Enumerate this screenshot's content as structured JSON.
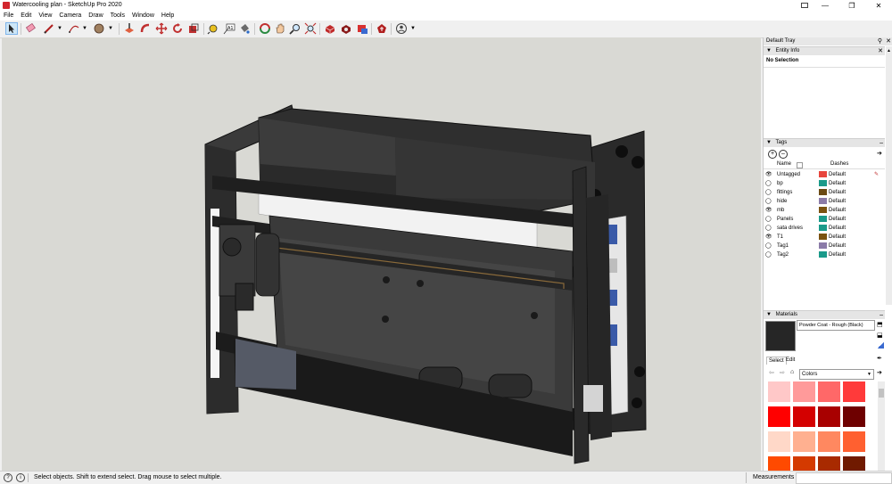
{
  "window": {
    "title": "Watercooling plan - SketchUp Pro 2020",
    "min": "—",
    "restore": "❐",
    "close": "✕"
  },
  "menu": [
    "File",
    "Edit",
    "View",
    "Camera",
    "Draw",
    "Tools",
    "Window",
    "Help"
  ],
  "toolbar": {
    "tools": [
      "select-tool",
      "eraser-tool",
      "line-tool",
      "arc-tool",
      "shapes-tool",
      "push-pull-tool",
      "move-tool",
      "rotate-tool",
      "scale-tool",
      "offset-tool",
      "tape-measure-tool",
      "text-tool",
      "paint-bucket-tool",
      "orbit-tool",
      "pan-tool",
      "zoom-tool",
      "zoom-extents-tool",
      "warehouse-tool",
      "extension-warehouse-tool",
      "layout-send-tool",
      "extension-manager-tool",
      "account-tool"
    ]
  },
  "tray": {
    "title": "Default Tray",
    "entity_info": {
      "label": "Entity Info",
      "status": "No Selection"
    },
    "tags": {
      "label": "Tags",
      "col_name": "Name",
      "col_dashes": "Dashes",
      "rows": [
        {
          "name": "Untagged",
          "color": "#e8453c",
          "dash": "Default",
          "visible": true
        },
        {
          "name": "bp",
          "color": "#1a9a8a",
          "dash": "Default",
          "visible": false
        },
        {
          "name": "fittings",
          "color": "#6a4a14",
          "dash": "Default",
          "visible": false
        },
        {
          "name": "hide",
          "color": "#8b7ba8",
          "dash": "Default",
          "visible": false
        },
        {
          "name": "mb",
          "color": "#7a5210",
          "dash": "Default",
          "visible": true
        },
        {
          "name": "Panels",
          "color": "#1a9a8a",
          "dash": "Default",
          "visible": false
        },
        {
          "name": "sata drives",
          "color": "#1a9a8a",
          "dash": "Default",
          "visible": false
        },
        {
          "name": "T1",
          "color": "#7a5210",
          "dash": "Default",
          "visible": true
        },
        {
          "name": "Tag1",
          "color": "#8b7ba8",
          "dash": "Default",
          "visible": false
        },
        {
          "name": "Tag2",
          "color": "#1a9a8a",
          "dash": "Default",
          "visible": false
        }
      ]
    },
    "materials": {
      "label": "Materials",
      "current": "Powder Coat - Rough (Black)",
      "tab_select": "Select",
      "tab_edit": "Edit",
      "library": "Colors",
      "swatches": [
        "#ffc8c8",
        "#ff9a9a",
        "#ff6868",
        "#ff3a3a",
        "#ff0000",
        "#d40000",
        "#a80000",
        "#6e0000",
        "#ffd8c8",
        "#ffb090",
        "#ff8860",
        "#ff6030",
        "#ff4a00",
        "#d43a00",
        "#a82a00",
        "#701a00"
      ]
    }
  },
  "status": {
    "message": "Select objects. Shift to extend select. Drag mouse to select multiple.",
    "measurements_label": "Measurements"
  }
}
